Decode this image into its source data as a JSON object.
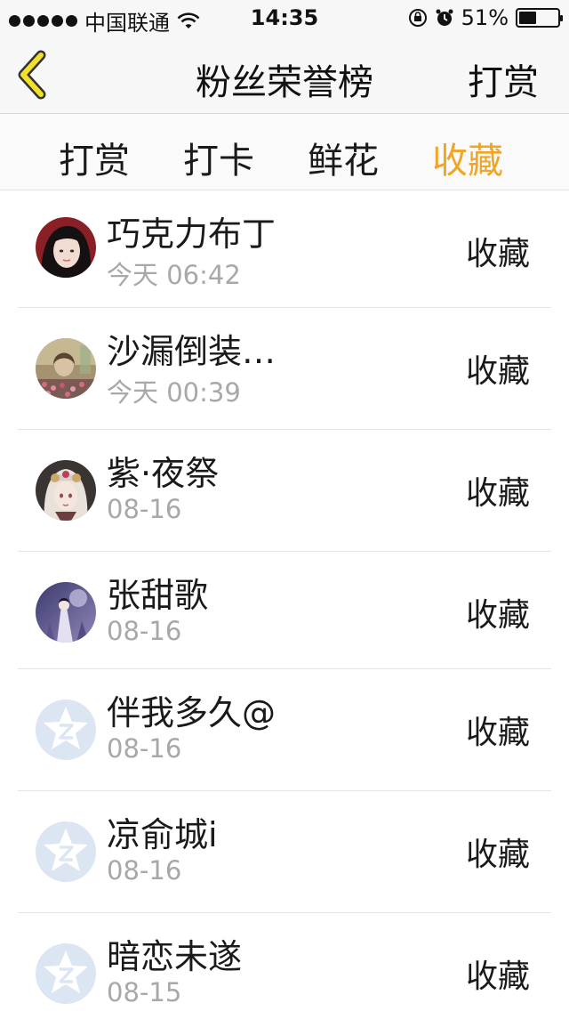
{
  "status_bar": {
    "carrier": "中国联通",
    "time": "14:35",
    "battery": "51%",
    "battery_level": 0.51
  },
  "nav": {
    "title": "粉丝荣誉榜",
    "right_label": "打赏"
  },
  "tabs": [
    {
      "label": "打赏"
    },
    {
      "label": "打卡"
    },
    {
      "label": "鲜花"
    },
    {
      "label": "收藏"
    }
  ],
  "active_tab": "收藏",
  "colors": {
    "accent": "#f0a624",
    "secondary_text": "#a8a8a8",
    "default_avatar": "#dbe6f2"
  },
  "list": [
    {
      "name": "巧克力布丁",
      "time": "今天 06:42",
      "type": "收藏",
      "avatar": "girl-photo-avatar"
    },
    {
      "name": "沙漏倒装…",
      "time": "今天 00:39",
      "type": "收藏",
      "avatar": "flowers-photo-avatar"
    },
    {
      "name": "紫·夜祭",
      "time": "08-16",
      "type": "收藏",
      "avatar": "anime-photo-avatar"
    },
    {
      "name": "张甜歌",
      "time": "08-16",
      "type": "收藏",
      "avatar": "purple-photo-avatar"
    },
    {
      "name": "伴我多久@",
      "time": "08-16",
      "type": "收藏",
      "avatar": "default-star-avatar"
    },
    {
      "name": "凉俞城i",
      "time": "08-16",
      "type": "收藏",
      "avatar": "default-star-avatar"
    },
    {
      "name": "暗恋未遂",
      "time": "08-15",
      "type": "收藏",
      "avatar": "default-star-avatar"
    }
  ]
}
